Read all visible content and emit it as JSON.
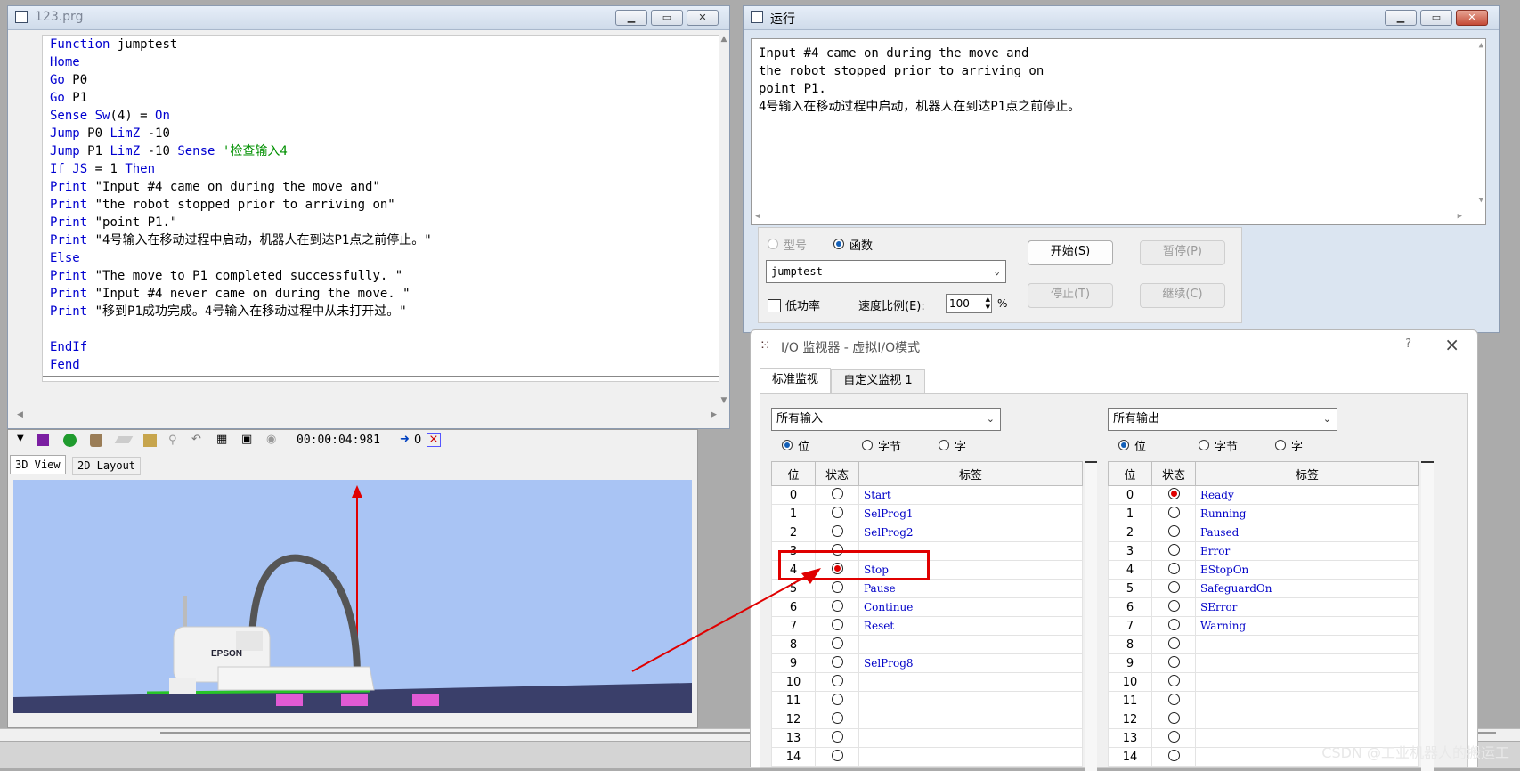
{
  "editor": {
    "title": "123.prg",
    "code_lines": [
      [
        [
          "kw",
          "Function"
        ],
        [
          "str",
          " jumptest"
        ]
      ],
      [
        [
          "kw",
          "Home"
        ]
      ],
      [
        [
          "kw",
          "Go"
        ],
        [
          "str",
          " P0"
        ]
      ],
      [
        [
          "kw",
          "Go"
        ],
        [
          "str",
          " P1"
        ]
      ],
      [
        [
          "kw",
          "Sense"
        ],
        [
          "str",
          " "
        ],
        [
          "kw",
          "Sw"
        ],
        [
          "str",
          "(4) = "
        ],
        [
          "kw",
          "On"
        ]
      ],
      [
        [
          "kw",
          "Jump"
        ],
        [
          "str",
          " P0 "
        ],
        [
          "kw",
          "LimZ"
        ],
        [
          "str",
          " -10"
        ]
      ],
      [
        [
          "kw",
          "Jump"
        ],
        [
          "str",
          " P1 "
        ],
        [
          "kw",
          "LimZ"
        ],
        [
          "str",
          " -10 "
        ],
        [
          "kw",
          "Sense"
        ],
        [
          "cm",
          " '检查输入4"
        ]
      ],
      [
        [
          "kw",
          "If"
        ],
        [
          "str",
          " "
        ],
        [
          "kw",
          "JS"
        ],
        [
          "str",
          " = 1 "
        ],
        [
          "kw",
          "Then"
        ]
      ],
      [
        [
          "kw",
          "Print"
        ],
        [
          "str",
          " \"Input #4 came on during the move and\""
        ]
      ],
      [
        [
          "kw",
          "Print"
        ],
        [
          "str",
          " \"the robot stopped prior to arriving on\""
        ]
      ],
      [
        [
          "kw",
          "Print"
        ],
        [
          "str",
          " \"point P1.\""
        ]
      ],
      [
        [
          "kw",
          "Print"
        ],
        [
          "str",
          " \"4号输入在移动过程中启动，机器人在到达P1点之前停止。\""
        ]
      ],
      [
        [
          "kw",
          "Else"
        ]
      ],
      [
        [
          "kw",
          "Print"
        ],
        [
          "str",
          " \"The move to P1 completed successfully. \""
        ]
      ],
      [
        [
          "kw",
          "Print"
        ],
        [
          "str",
          " \"Input #4 never came on during the move. \""
        ]
      ],
      [
        [
          "kw",
          "Print"
        ],
        [
          "str",
          " \"移到P1成功完成。4号输入在移动过程中从未打开过。\""
        ]
      ],
      [],
      [
        [
          "kw",
          "EndIf"
        ]
      ],
      [
        [
          "kw",
          "Fend"
        ]
      ]
    ]
  },
  "run_window": {
    "title": "运行",
    "output_lines": [
      "Input #4 came on during the move and",
      "the robot stopped prior to arriving on",
      "point P1.",
      "4号输入在移动过程中启动，机器人在到达P1点之前停止。"
    ],
    "radio_model": "型号",
    "radio_function": "函数",
    "function_value": "jumptest",
    "low_power": "低功率",
    "speed_label": "速度比例(E):",
    "speed_value": "100",
    "speed_unit": "%",
    "buttons": {
      "start": "开始(S)",
      "pause": "暂停(P)",
      "stop": "停止(T)",
      "continue": "继续(C)"
    }
  },
  "sim": {
    "timer": "00:00:04:981",
    "arrow_value": "0",
    "tabs": [
      "3D View",
      "2D Layout"
    ],
    "robot_brand": "EPSON"
  },
  "io_monitor": {
    "title": "I/O 监视器 - 虚拟I/O模式",
    "help": "?",
    "close": "×",
    "tabs": [
      "标准监视",
      "自定义监视 1"
    ],
    "inputs": {
      "select": "所有输入",
      "modes": [
        "位",
        "字节",
        "字"
      ],
      "headers": [
        "位",
        "状态",
        "标签"
      ],
      "rows": [
        {
          "bit": "0",
          "on": false,
          "label": "Start"
        },
        {
          "bit": "1",
          "on": false,
          "label": "SelProg1"
        },
        {
          "bit": "2",
          "on": false,
          "label": "SelProg2"
        },
        {
          "bit": "3",
          "on": false,
          "label": ""
        },
        {
          "bit": "4",
          "on": true,
          "label": "Stop"
        },
        {
          "bit": "5",
          "on": false,
          "label": "Pause"
        },
        {
          "bit": "6",
          "on": false,
          "label": "Continue"
        },
        {
          "bit": "7",
          "on": false,
          "label": "Reset"
        },
        {
          "bit": "8",
          "on": false,
          "label": ""
        },
        {
          "bit": "9",
          "on": false,
          "label": "SelProg8"
        },
        {
          "bit": "10",
          "on": false,
          "label": ""
        },
        {
          "bit": "11",
          "on": false,
          "label": ""
        },
        {
          "bit": "12",
          "on": false,
          "label": ""
        },
        {
          "bit": "13",
          "on": false,
          "label": ""
        },
        {
          "bit": "14",
          "on": false,
          "label": ""
        }
      ]
    },
    "outputs": {
      "select": "所有输出",
      "modes": [
        "位",
        "字节",
        "字"
      ],
      "headers": [
        "位",
        "状态",
        "标签"
      ],
      "rows": [
        {
          "bit": "0",
          "on": true,
          "label": "Ready"
        },
        {
          "bit": "1",
          "on": false,
          "label": "Running"
        },
        {
          "bit": "2",
          "on": false,
          "label": "Paused"
        },
        {
          "bit": "3",
          "on": false,
          "label": "Error"
        },
        {
          "bit": "4",
          "on": false,
          "label": "EStopOn"
        },
        {
          "bit": "5",
          "on": false,
          "label": "SafeguardOn"
        },
        {
          "bit": "6",
          "on": false,
          "label": "SError"
        },
        {
          "bit": "7",
          "on": false,
          "label": "Warning"
        },
        {
          "bit": "8",
          "on": false,
          "label": ""
        },
        {
          "bit": "9",
          "on": false,
          "label": ""
        },
        {
          "bit": "10",
          "on": false,
          "label": ""
        },
        {
          "bit": "11",
          "on": false,
          "label": ""
        },
        {
          "bit": "12",
          "on": false,
          "label": ""
        },
        {
          "bit": "13",
          "on": false,
          "label": ""
        },
        {
          "bit": "14",
          "on": false,
          "label": ""
        }
      ]
    }
  },
  "watermark": "CSDN @工业机器人的搬运工",
  "colors": {
    "highlight": "#e00000",
    "keyword": "#0000d0",
    "comment": "#009000",
    "label": "#0000c8",
    "view_bg": "#a9c4f4"
  }
}
